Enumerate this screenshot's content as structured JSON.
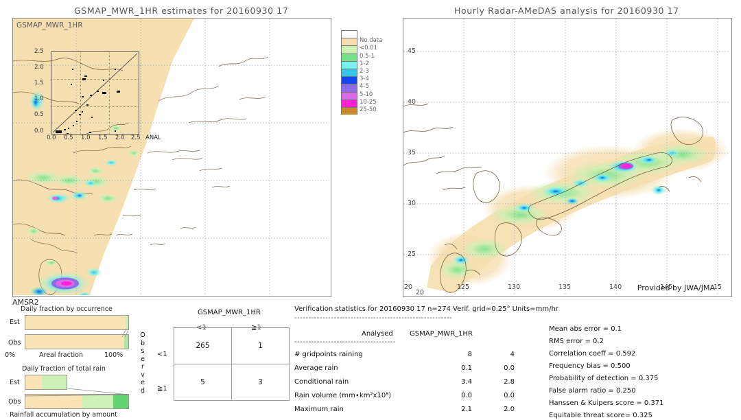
{
  "left_panel": {
    "title": "GSMAP_MWR_1HR estimates for 20160930 17",
    "corner_tag": "GSMAP_MWR_1HR",
    "footer_tag": "AMSR2",
    "inset": {
      "x_label": "ANAL",
      "ticks": [
        "0.0",
        "0.5",
        "1.0",
        "1.5",
        "2.0",
        "2.5"
      ]
    }
  },
  "right_panel": {
    "title": "Hourly Radar-AMeDAS analysis for 20160930 17",
    "credit": "Provided by JWA/JMA",
    "lat_ticks": [
      "45",
      "40",
      "35",
      "30",
      "25",
      "20"
    ],
    "lon_ticks": [
      "125",
      "130",
      "135",
      "140",
      "145",
      "15"
    ],
    "corner_lat": "20",
    "corner_lon": "20"
  },
  "colorbar": {
    "labels": [
      "",
      "No data",
      "<0.01",
      "0.5-1",
      "1-2",
      "2-3",
      "3-4",
      "4-5",
      "5-10",
      "10-25",
      "25-50"
    ],
    "colors": [
      "#ffffff",
      "#f6dfb0",
      "#cdf0b6",
      "#76e38a",
      "#7cf0ee",
      "#34c8e8",
      "#1546f0",
      "#8d6ae8",
      "#d96ae8",
      "#ff22d4",
      "#c98b2e"
    ]
  },
  "bars": {
    "chart1": {
      "title": "Daily fraction by occurrence",
      "axis_label": "Areal fraction",
      "axis_min": "0%",
      "axis_max": "100%",
      "rows": [
        {
          "label": "Est",
          "segments": [
            {
              "color": "#fae3b5",
              "pct": 97.5
            },
            {
              "color": "#cdf0b6",
              "pct": 2.5
            }
          ]
        },
        {
          "label": "Obs",
          "segments": [
            {
              "color": "#fae3b5",
              "pct": 96.0
            },
            {
              "color": "#aee8a0",
              "pct": 4.0
            }
          ]
        }
      ]
    },
    "chart2": {
      "title": "Daily fraction of total rain",
      "axis_label": "Rainfall accumulation by amount",
      "rows": [
        {
          "label": "Est",
          "width_pct": 41,
          "segments": [
            {
              "color": "#fae3b5",
              "pct": 40
            },
            {
              "color": "#cdf0b6",
              "pct": 60
            }
          ]
        },
        {
          "label": "Obs",
          "width_pct": 100,
          "segments": [
            {
              "color": "#fae3b5",
              "pct": 55
            },
            {
              "color": "#cdf0b6",
              "pct": 30
            },
            {
              "color": "#63d46e",
              "pct": 15
            }
          ]
        }
      ]
    }
  },
  "contingency": {
    "model_header": "GSMAP_MWR_1HR",
    "col_headers": [
      "<1",
      "≧1"
    ],
    "row_headers": [
      "<1",
      "≧1"
    ],
    "observed_label": "Observed",
    "cells": [
      [
        "265",
        "1"
      ],
      [
        "5",
        "3"
      ]
    ]
  },
  "verification": {
    "header": "Verification statistics for 20160930 17  n=274  Verif. grid=0.25°  Units=mm/hr",
    "rule_top": "--------------------------------------------------------",
    "col_analysed": "Analysed",
    "col_model": "GSMAP_MWR_1HR",
    "rule_mid": "------------------------------------",
    "rows": [
      {
        "label": "# gridpoints raining",
        "analysed": "8",
        "model": "4"
      },
      {
        "label": "Average rain",
        "analysed": "0.1",
        "model": "0.0"
      },
      {
        "label": "Conditional rain",
        "analysed": "3.4",
        "model": "2.8"
      },
      {
        "label": "Rain volume (mm∙km²x10⁸)",
        "analysed": "0.0",
        "model": "0.0"
      },
      {
        "label": "Maximum rain",
        "analysed": "2.1",
        "model": "2.0"
      }
    ],
    "scores": [
      "Mean abs error = 0.1",
      "RMS error = 0.2",
      "Correlation coeff = 0.592",
      "Frequency bias = 0.500",
      "Probability of detection = 0.375",
      "False alarm ratio = 0.250",
      "Hanssen & Kuipers score = 0.371",
      "Equitable threat score= 0.325"
    ]
  }
}
